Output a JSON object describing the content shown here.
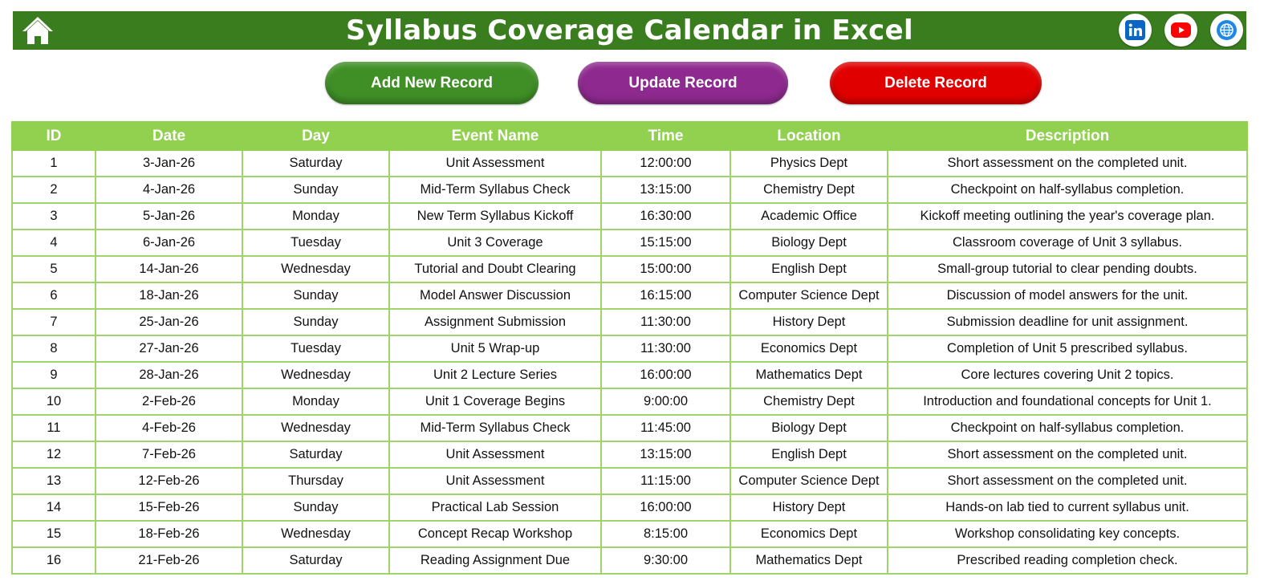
{
  "header": {
    "title": "Syllabus Coverage Calendar in Excel",
    "home_icon": "home-icon",
    "social": [
      {
        "icon": "linkedin-icon",
        "color": "#0a66c2"
      },
      {
        "icon": "youtube-icon",
        "color": "#ff0000"
      },
      {
        "icon": "globe-icon",
        "color": "#1e88e5"
      }
    ],
    "bg_color": "#3a7d1e"
  },
  "actions": {
    "add_label": "Add New Record",
    "update_label": "Update Record",
    "delete_label": "Delete Record"
  },
  "table": {
    "columns": [
      "ID",
      "Date",
      "Day",
      "Event Name",
      "Time",
      "Location",
      "Description"
    ],
    "header_color": "#92d050",
    "rows": [
      [
        "1",
        "3-Jan-26",
        "Saturday",
        "Unit Assessment",
        "12:00:00",
        "Physics Dept",
        "Short assessment on the completed unit."
      ],
      [
        "2",
        "4-Jan-26",
        "Sunday",
        "Mid-Term Syllabus Check",
        "13:15:00",
        "Chemistry Dept",
        "Checkpoint on half-syllabus completion."
      ],
      [
        "3",
        "5-Jan-26",
        "Monday",
        "New Term Syllabus Kickoff",
        "16:30:00",
        "Academic Office",
        "Kickoff meeting outlining the year's coverage plan."
      ],
      [
        "4",
        "6-Jan-26",
        "Tuesday",
        "Unit 3 Coverage",
        "15:15:00",
        "Biology Dept",
        "Classroom coverage of Unit 3 syllabus."
      ],
      [
        "5",
        "14-Jan-26",
        "Wednesday",
        "Tutorial and Doubt Clearing",
        "15:00:00",
        "English Dept",
        "Small-group tutorial to clear pending doubts."
      ],
      [
        "6",
        "18-Jan-26",
        "Sunday",
        "Model Answer Discussion",
        "16:15:00",
        "Computer Science Dept",
        "Discussion of model answers for the unit."
      ],
      [
        "7",
        "25-Jan-26",
        "Sunday",
        "Assignment Submission",
        "11:30:00",
        "History Dept",
        "Submission deadline for unit assignment."
      ],
      [
        "8",
        "27-Jan-26",
        "Tuesday",
        "Unit 5 Wrap-up",
        "11:30:00",
        "Economics Dept",
        "Completion of Unit 5 prescribed syllabus."
      ],
      [
        "9",
        "28-Jan-26",
        "Wednesday",
        "Unit 2 Lecture Series",
        "16:00:00",
        "Mathematics Dept",
        "Core lectures covering Unit 2 topics."
      ],
      [
        "10",
        "2-Feb-26",
        "Monday",
        "Unit 1 Coverage Begins",
        "9:00:00",
        "Chemistry Dept",
        "Introduction and foundational concepts for Unit 1."
      ],
      [
        "11",
        "4-Feb-26",
        "Wednesday",
        "Mid-Term Syllabus Check",
        "11:45:00",
        "Biology Dept",
        "Checkpoint on half-syllabus completion."
      ],
      [
        "12",
        "7-Feb-26",
        "Saturday",
        "Unit Assessment",
        "13:15:00",
        "English Dept",
        "Short assessment on the completed unit."
      ],
      [
        "13",
        "12-Feb-26",
        "Thursday",
        "Unit Assessment",
        "11:15:00",
        "Computer Science Dept",
        "Short assessment on the completed unit."
      ],
      [
        "14",
        "15-Feb-26",
        "Sunday",
        "Practical Lab Session",
        "16:00:00",
        "History Dept",
        "Hands-on lab tied to current syllabus unit."
      ],
      [
        "15",
        "18-Feb-26",
        "Wednesday",
        "Concept Recap Workshop",
        "8:15:00",
        "Economics Dept",
        "Workshop consolidating key concepts."
      ],
      [
        "16",
        "21-Feb-26",
        "Saturday",
        "Reading Assignment Due",
        "9:30:00",
        "Mathematics Dept",
        "Prescribed reading completion check."
      ]
    ]
  }
}
